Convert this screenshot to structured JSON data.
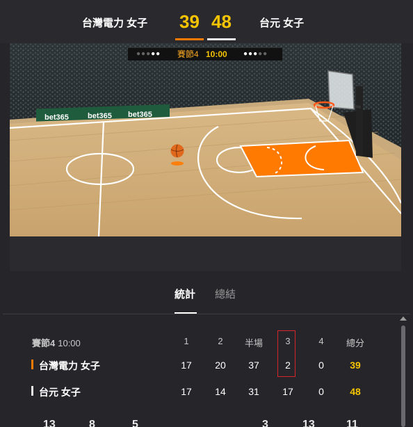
{
  "header": {
    "home_team": "台灣電力 女子",
    "away_team": "台元 女子",
    "home_score": "39",
    "away_score": "48"
  },
  "period_bar": {
    "label": "賽節4",
    "time": "10:00"
  },
  "court": {
    "ads": [
      "bet365",
      "bet365",
      "bet365"
    ]
  },
  "tabs": [
    {
      "label": "統計",
      "active": true
    },
    {
      "label": "總結",
      "active": false
    }
  ],
  "scoreboard": {
    "period_label": "賽節4",
    "time": "10:00",
    "columns": [
      "1",
      "2",
      "半場",
      "3",
      "4",
      "總分"
    ],
    "rows": [
      {
        "team": "台灣電力 女子",
        "color": "#ff7a00",
        "values": [
          "17",
          "20",
          "37",
          "2",
          "0",
          "39"
        ]
      },
      {
        "team": "台元 女子",
        "color": "#e8e8e8",
        "values": [
          "17",
          "14",
          "31",
          "17",
          "0",
          "48"
        ]
      }
    ],
    "partial_row": [
      "13",
      "8",
      "5",
      "3",
      "13",
      "11"
    ]
  },
  "colors": {
    "accent": "#f5c400",
    "home": "#ff7a00",
    "highlight": "#d6262a"
  }
}
